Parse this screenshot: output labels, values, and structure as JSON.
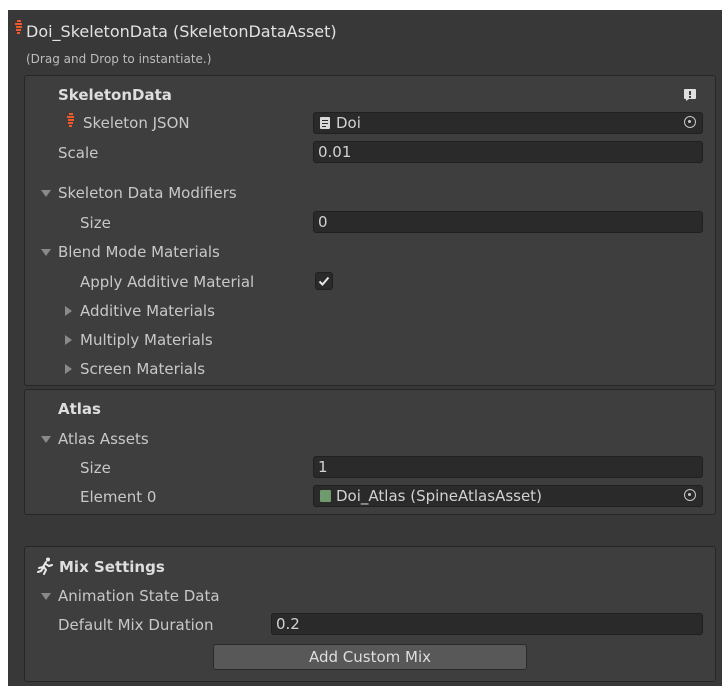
{
  "header": {
    "title": "Doi_SkeletonData (SkeletonDataAsset)",
    "subtitle": "(Drag and Drop to instantiate.)"
  },
  "skeleton_panel": {
    "heading": "SkeletonData",
    "skeleton_json_label": "Skeleton JSON",
    "skeleton_json_value": "Doi",
    "scale_label": "Scale",
    "scale_value": "0.01",
    "modifiers_label": "Skeleton Data Modifiers",
    "modifiers_size_label": "Size",
    "modifiers_size_value": "0",
    "blend_label": "Blend Mode Materials",
    "apply_additive_label": "Apply Additive Material",
    "apply_additive_checked": true,
    "additive_label": "Additive Materials",
    "multiply_label": "Multiply Materials",
    "screen_label": "Screen Materials"
  },
  "atlas_panel": {
    "heading": "Atlas",
    "assets_label": "Atlas Assets",
    "size_label": "Size",
    "size_value": "1",
    "element_label": "Element 0",
    "element_value": "Doi_Atlas (SpineAtlasAsset)"
  },
  "mix_panel": {
    "heading": "Mix Settings",
    "state_label": "Animation State Data",
    "duration_label": "Default Mix Duration",
    "duration_value": "0.2",
    "add_button": "Add Custom Mix"
  },
  "colors": {
    "background": "#383838",
    "panel": "#3e3e3e",
    "field": "#2a2a2a",
    "spine_icon": "#f05a28",
    "atlas_icon": "#6e9a6e"
  }
}
